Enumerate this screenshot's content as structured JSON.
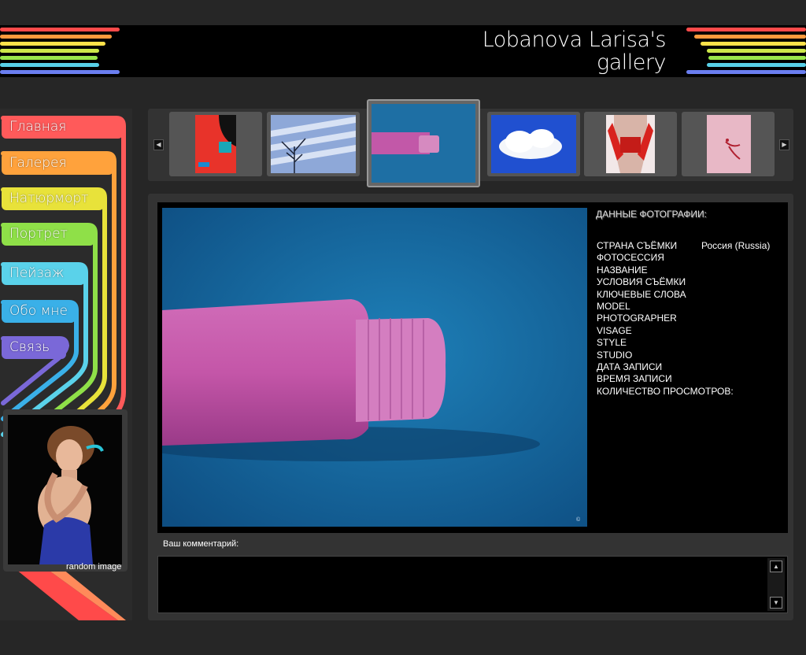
{
  "header": {
    "title_line1": "Lobanova Larisa's",
    "title_line2": "gallery"
  },
  "colors": {
    "rainbow": [
      "#ff4a4a",
      "#ff9a3c",
      "#ffe24a",
      "#9ae84a",
      "#58d0e8",
      "#4a8ef0",
      "#9a6ae8"
    ],
    "background": "#262626",
    "panel": "#333333"
  },
  "nav": {
    "items": [
      {
        "label": "Главная",
        "color": "#ff5a5a"
      },
      {
        "label": "Галерея",
        "color": "#ffa23c"
      },
      {
        "label": "Натюрморт",
        "color": "#e8e23a"
      },
      {
        "label": "Портрет",
        "color": "#8fe048"
      },
      {
        "label": "Пейзаж",
        "color": "#5ad2ea"
      },
      {
        "label": "Обо мне",
        "color": "#3ab0e8"
      },
      {
        "label": "Связь",
        "color": "#7a68d8"
      }
    ]
  },
  "random": {
    "label": "random image"
  },
  "thumbnails": {
    "prev_icon": "arrow-left-icon",
    "next_icon": "arrow-right-icon",
    "prev_glyph": "◀",
    "next_glyph": "▶",
    "items": [
      {
        "name": "thumb-red-poster"
      },
      {
        "name": "thumb-tree-shadows"
      },
      {
        "name": "thumb-pink-roll",
        "active": true
      },
      {
        "name": "thumb-clouds"
      },
      {
        "name": "thumb-red-gloves"
      },
      {
        "name": "thumb-pink-still"
      }
    ]
  },
  "photo_info": {
    "title": "ДАННЫЕ ФОТОГРАФИИ:",
    "fields": [
      {
        "label": "СТРАНА СЪЁМКИ",
        "value": "Россия (Russia)"
      },
      {
        "label": "ФОТОСЕССИЯ",
        "value": ""
      },
      {
        "label": "НАЗВАНИЕ",
        "value": ""
      },
      {
        "label": "УСЛОВИЯ СЪЁМКИ",
        "value": ""
      },
      {
        "label": "КЛЮЧЕВЫЕ СЛОВА",
        "value": ""
      },
      {
        "label": "MODEL",
        "value": ""
      },
      {
        "label": "PHOTOGRAPHER",
        "value": ""
      },
      {
        "label": "VISAGE",
        "value": ""
      },
      {
        "label": "STYLE",
        "value": ""
      },
      {
        "label": "STUDIO",
        "value": ""
      },
      {
        "label": "ДАТА ЗАПИСИ",
        "value": ""
      },
      {
        "label": "ВРЕМЯ ЗАПИСИ",
        "value": ""
      },
      {
        "label": "КОЛИЧЕСТВО ПРОСМОТРОВ:",
        "value": ""
      }
    ]
  },
  "comment": {
    "label": "Ваш комментарий:",
    "value": "",
    "scroll_up_glyph": "▲",
    "scroll_down_glyph": "▼"
  }
}
